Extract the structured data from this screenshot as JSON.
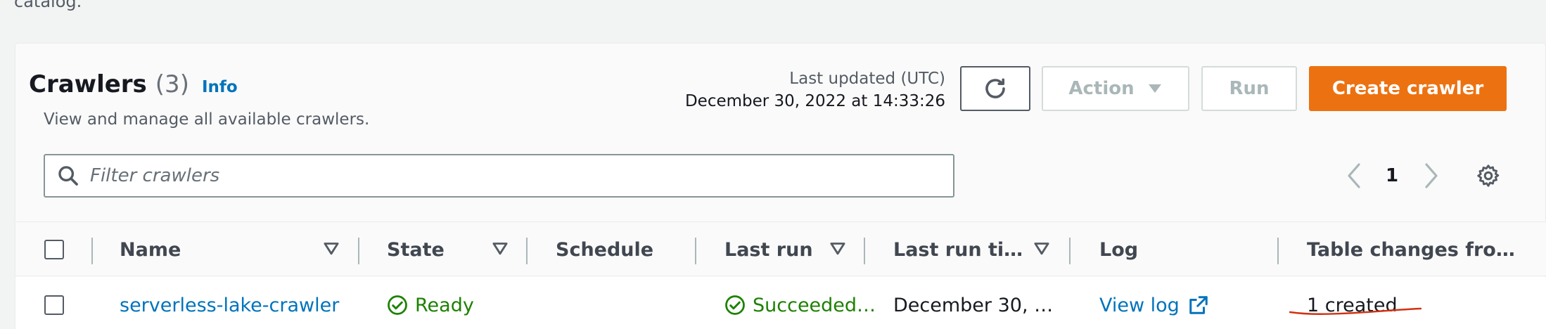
{
  "page": {
    "top_text": "catalog."
  },
  "header": {
    "title": "Crawlers",
    "count": "(3)",
    "info_label": "Info",
    "subtitle": "View and manage all available crawlers.",
    "last_updated_label": "Last updated (UTC)",
    "last_updated_value": "December 30, 2022 at 14:33:26"
  },
  "toolbar": {
    "refresh_icon": "refresh-icon",
    "action_label": "Action",
    "run_label": "Run",
    "create_label": "Create crawler",
    "create_color": "#ec7211"
  },
  "search": {
    "placeholder": "Filter crawlers",
    "value": ""
  },
  "pagination": {
    "current_page": "1"
  },
  "table": {
    "columns": [
      {
        "label": "Name",
        "sortable": true
      },
      {
        "label": "State",
        "sortable": true
      },
      {
        "label": "Schedule",
        "sortable": false
      },
      {
        "label": "Last run",
        "sortable": true
      },
      {
        "label": "Last run ti…",
        "sortable": true
      },
      {
        "label": "Log",
        "sortable": false
      },
      {
        "label": "Table changes fro…",
        "sortable": false
      }
    ],
    "rows": [
      {
        "name": "serverless-lake-crawler",
        "state": "Ready",
        "schedule": "",
        "last_run": "Succeeded…",
        "last_run_time": "December 30, …",
        "log": "View log",
        "table_changes": "1 created"
      }
    ]
  },
  "colors": {
    "link": "#0073bb",
    "success": "#1d8102",
    "annotation": "#d13212"
  }
}
